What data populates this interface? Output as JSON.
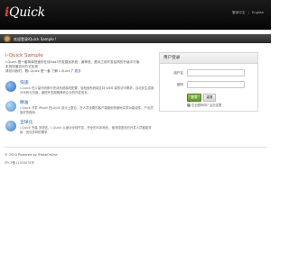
{
  "header": {
    "logo_prefix": "i",
    "logo_text": "Quick",
    "nav": [
      "繁体中文",
      "English"
    ],
    "nav_separator": "|"
  },
  "bar": {
    "crumb": "欢迎登录iQuick Sample !"
  },
  "main": {
    "title": "i-Quick Sample",
    "intro": "i-Quick 是一套简单快速的在线SaaS开发建设系统，速率低，是对之前开发结构的升级平行版本的快速访问方式实现",
    "intro_line2": "请访问我们，看i-Quick 是一套 了解 i-Quick了",
    "intro_link": "更多",
    "features": [
      {
        "title": "快速",
        "desc": "i-Quick 在少量代码即可完成系统模块配置，轻松使系统能支持 WEB 端的访问需求，自动化生成部分代码与页面，缩短开发周期降低企业的开发成本。",
        "color": "#2f6fc1"
      },
      {
        "title": "精准",
        "desc": "i-Quick 开发 iPanel 在UI/UX 设计上整合，在人员设置的客户端使用快速地实现功能组件，产出质量好的程序。",
        "color": "#4f93d8"
      },
      {
        "title": "全球化",
        "desc": "i-Quick 完善 多语言，i-Quick 从面对全球开发，完全的可本地化，使多国语言的开发人员都能享用，优化多种的需求",
        "color": "#3a7cc6"
      }
    ]
  },
  "login": {
    "heading": "用户登录",
    "user_label": "用户名",
    "user_placeholder": "",
    "pass_label": "密码",
    "pass_placeholder": "",
    "login_btn": "登录",
    "reset_btn": "重置",
    "forgot": "忘记密码吗? 点击这里"
  },
  "footer": {
    "copyright": "© 2020 Powered by iFalseOnline",
    "icp": "沪ICP备12345678号"
  }
}
